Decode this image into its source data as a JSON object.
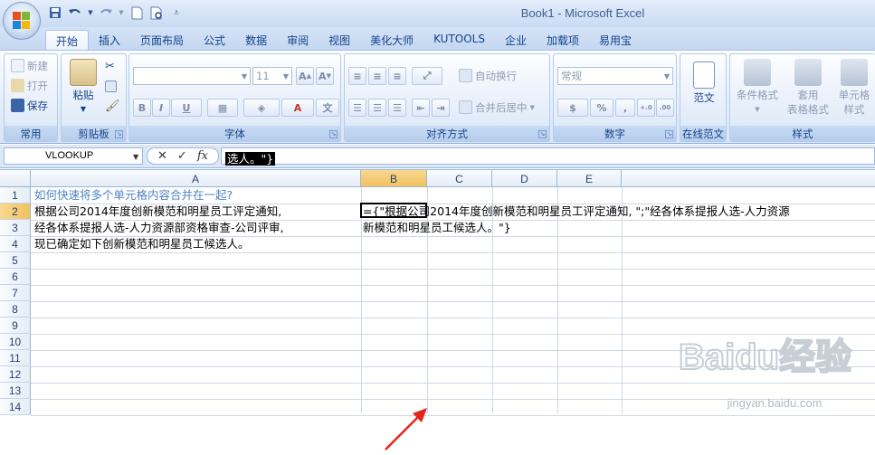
{
  "window": {
    "title": "Book1 - Microsoft Excel"
  },
  "qat": {
    "save_icon": "save-icon",
    "undo_icon": "undo-icon",
    "redo_icon": "redo-icon",
    "new_icon": "new-doc-icon",
    "preview_icon": "print-preview-icon",
    "customize_icon": "chevron-down-icon"
  },
  "tabs": [
    {
      "label": "开始",
      "active": true
    },
    {
      "label": "插入"
    },
    {
      "label": "页面布局"
    },
    {
      "label": "公式"
    },
    {
      "label": "数据"
    },
    {
      "label": "审阅"
    },
    {
      "label": "视图"
    },
    {
      "label": "美化大师"
    },
    {
      "label": "KUTOOLS"
    },
    {
      "label": "企业"
    },
    {
      "label": "加载项"
    },
    {
      "label": "易用宝"
    }
  ],
  "ribbon": {
    "common": {
      "label": "常用",
      "new": "新建",
      "open": "打开",
      "save": "保存"
    },
    "clipboard": {
      "label": "剪贴板",
      "paste": "粘贴"
    },
    "font": {
      "label": "字体",
      "size": "11",
      "bold": "B",
      "italic": "I",
      "underline": "U"
    },
    "alignment": {
      "label": "对齐方式",
      "wrap": "自动换行",
      "merge": "合并后居中"
    },
    "number": {
      "label": "数字",
      "format": "常规",
      "percent": "%",
      "comma": ","
    },
    "online": {
      "label": "在线范文",
      "template": "范文"
    },
    "styles": {
      "label": "样式",
      "conditional": "条件格式",
      "table_line1": "套用",
      "table_line2": "表格格式",
      "cell_line1": "单元格",
      "cell_line2": "样式"
    }
  },
  "formula_bar": {
    "name_box": "VLOOKUP",
    "cancel_glyph": "✕",
    "enter_glyph": "✓",
    "fx_glyph": "fx",
    "formula_text": "选人。\"}"
  },
  "grid": {
    "columns": [
      "A",
      "B",
      "C",
      "D",
      "E"
    ],
    "rows": [
      "1",
      "2",
      "3",
      "4",
      "5",
      "6",
      "7",
      "8",
      "9",
      "10",
      "11",
      "12",
      "13",
      "14"
    ],
    "cells": {
      "A1": "如何快速将多个单元格内容合并在一起?",
      "A2": "根据公司2014年度创新模范和明星员工评定通知,",
      "A3": "经各体系提报人选-人力资源部资格审查-公司评审,",
      "A4": "现已确定如下创新模范和明星员工候选人。",
      "B2": "={\"根据公司2014年度创新模范和明星员工评定通知, \";\"经各体系提报人选-人力资源",
      "B3": "新模范和明星员工候选人。\"}"
    },
    "selected_column": "B",
    "selected_row": "2"
  },
  "colors": {
    "accent": "#15428b",
    "title_cell": "#4d84c4",
    "arrow": "#e8231e"
  },
  "watermark": {
    "brand": "Baidu经验",
    "url": "jingyan.baidu.com"
  }
}
